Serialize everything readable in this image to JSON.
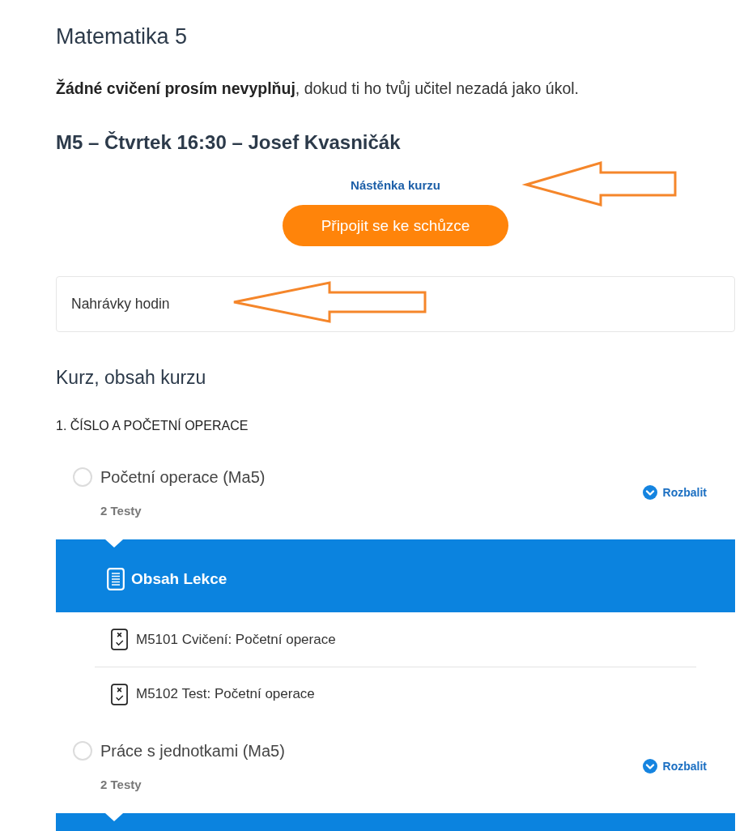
{
  "page": {
    "title": "Matematika 5",
    "notice": "**Žádné cvičení prosím nevyplňuj**, dokud ti ho tvůj učitel nezadá jako úkol."
  },
  "class_info": {
    "heading": "M5 – Čtvrtek 16:30 – Josef Kvasničák",
    "board_link": {
      "text": "Nástěnka kurzu",
      "annotated": true
    },
    "join_button": "Připojit se ke schůzce",
    "recordings_card": {
      "text": "Nahrávky hodin",
      "annotated": true
    }
  },
  "course": {
    "heading": "Kurz, obsah kurzu",
    "chapters": [
      {
        "title": "1. ČÍSLO A POČETNÍ OPERACE",
        "lessons": [
          {
            "title": "Početní operace (Ma5)",
            "count": "2 Testy",
            "toggle": "Rozbalit",
            "completed": false,
            "expanded": true,
            "panel": {
              "title": "Obsah Lekce",
              "items": [
                {
                  "title": "M5101 Cvičení: Početní operace"
                },
                {
                  "title": "M5102 Test: Početní operace"
                }
              ]
            }
          },
          {
            "title": "Práce s jednotkami (Ma5)",
            "count": "2 Testy",
            "toggle": "Rozbalit",
            "completed": false,
            "expanded": true
          }
        ]
      }
    ]
  }
}
